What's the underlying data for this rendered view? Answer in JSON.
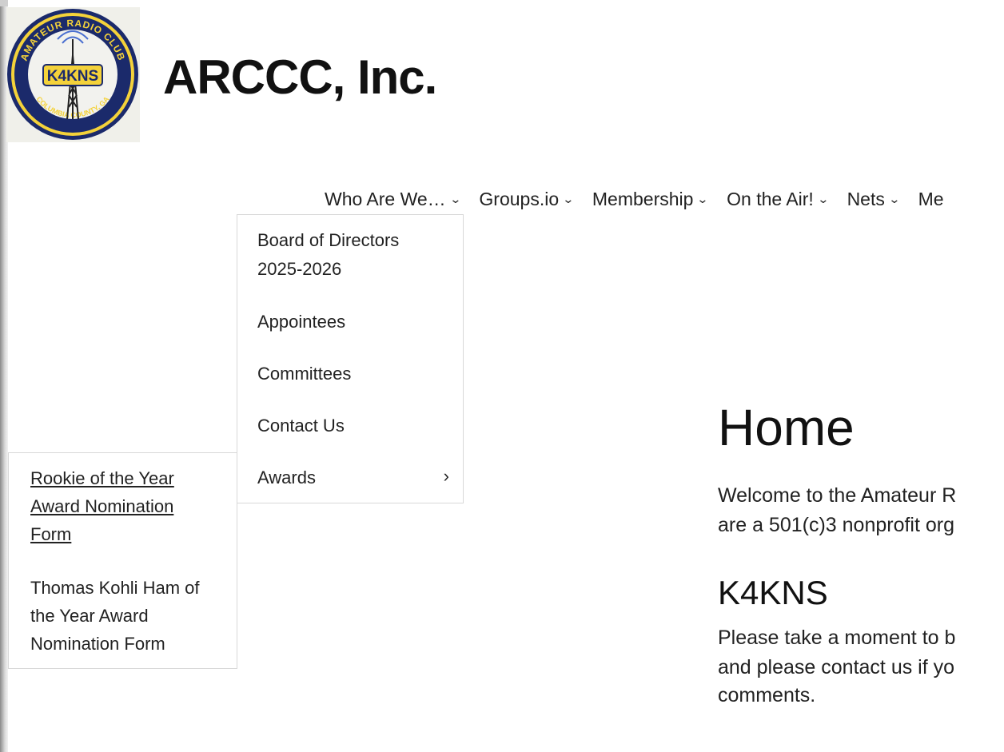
{
  "site": {
    "title": "ARCCC, Inc.",
    "logo": {
      "top_text": "AMATEUR RADIO CLUB",
      "callsign": "K4KNS",
      "bottom_text": "COLUMBIA COUNTY, GA"
    }
  },
  "nav": {
    "items": [
      {
        "label": "Who Are We…"
      },
      {
        "label": "Groups.io"
      },
      {
        "label": "Membership"
      },
      {
        "label": "On the Air!"
      },
      {
        "label": "Nets"
      },
      {
        "label": "Me"
      }
    ]
  },
  "dropdown": {
    "items": [
      {
        "label": "Board of Directors 2025-2026"
      },
      {
        "label": "Appointees"
      },
      {
        "label": "Committees"
      },
      {
        "label": "Contact Us"
      },
      {
        "label": "Awards"
      }
    ],
    "awards_arrow": "›"
  },
  "submenu": {
    "items": [
      {
        "label": "Rookie of the Year Award Nomination Form"
      },
      {
        "label": "Thomas Kohli Ham of the Year Award Nomination Form"
      }
    ]
  },
  "content": {
    "heading": "Home",
    "intro_line1": "Welcome to the Amateur R",
    "intro_line2": "are a 501(c)3 nonprofit org",
    "subheading": "K4KNS",
    "body_line1": "Please take a moment to b",
    "body_line2": "and please contact us if yo",
    "body_line3": "comments."
  }
}
